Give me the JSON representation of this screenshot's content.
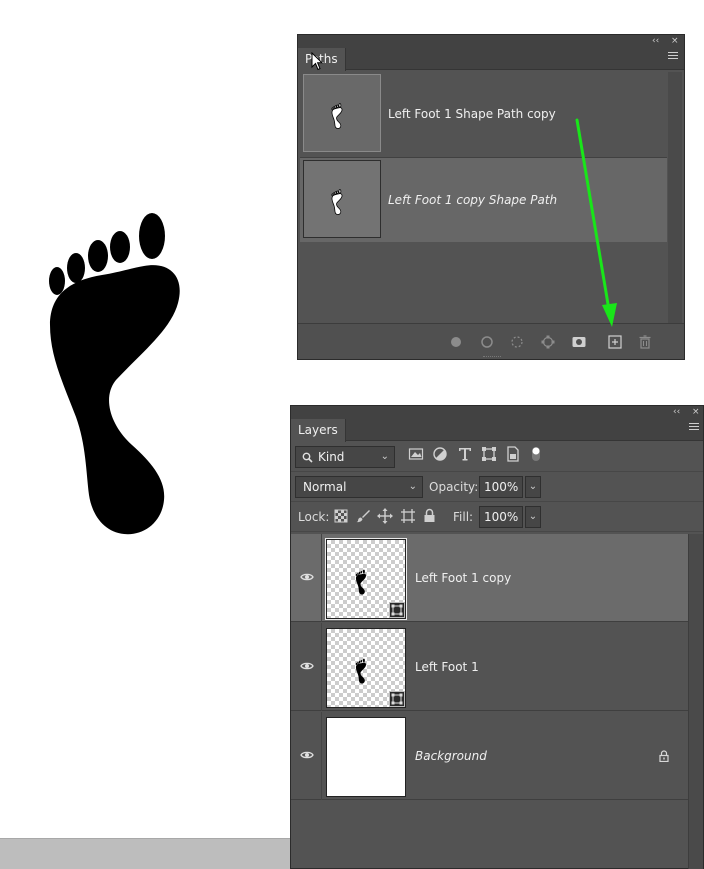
{
  "colors": {
    "panel_bg": "#535353",
    "selected_row": "#676767",
    "annotation_arrow": "#19e619",
    "shape_fill": "#000000"
  },
  "paths_panel": {
    "tab_label": "Paths",
    "collapse_glyph": "‹‹",
    "close_glyph": "×",
    "menu_icon": "hamburger-menu-icon",
    "paths": [
      {
        "name": "Left Foot 1 Shape Path copy",
        "selected": false,
        "italic": false
      },
      {
        "name": "Left Foot 1 copy Shape Path",
        "selected": true,
        "italic": true
      }
    ],
    "footer_icons": [
      "fill-path-icon",
      "stroke-path-icon",
      "load-selection-icon",
      "make-work-path-icon",
      "add-mask-icon",
      "new-path-icon",
      "delete-path-icon"
    ]
  },
  "layers_panel": {
    "tab_label": "Layers",
    "collapse_glyph": "‹‹",
    "close_glyph": "×",
    "filter": {
      "value": "Kind",
      "icon": "search-icon"
    },
    "filter_icons": [
      "pixel-filter-icon",
      "adjustment-filter-icon",
      "type-filter-icon",
      "shape-filter-icon",
      "smart-object-filter-icon",
      "filter-toggle-icon"
    ],
    "blend_mode": "Normal",
    "opacity_label": "Opacity:",
    "opacity_value": "100%",
    "lock_label": "Lock:",
    "lock_icons": [
      "lock-transparent-pixels-icon",
      "lock-image-pixels-icon",
      "lock-position-icon",
      "lock-artboard-icon",
      "lock-all-icon"
    ],
    "fill_label": "Fill:",
    "fill_value": "100%",
    "layers": [
      {
        "name": "Left Foot 1 copy",
        "selected": true,
        "type": "shape",
        "italic": false,
        "locked": false
      },
      {
        "name": "Left Foot 1",
        "selected": false,
        "type": "shape",
        "italic": false,
        "locked": false
      },
      {
        "name": "Background",
        "selected": false,
        "type": "background",
        "italic": true,
        "locked": true
      }
    ]
  }
}
